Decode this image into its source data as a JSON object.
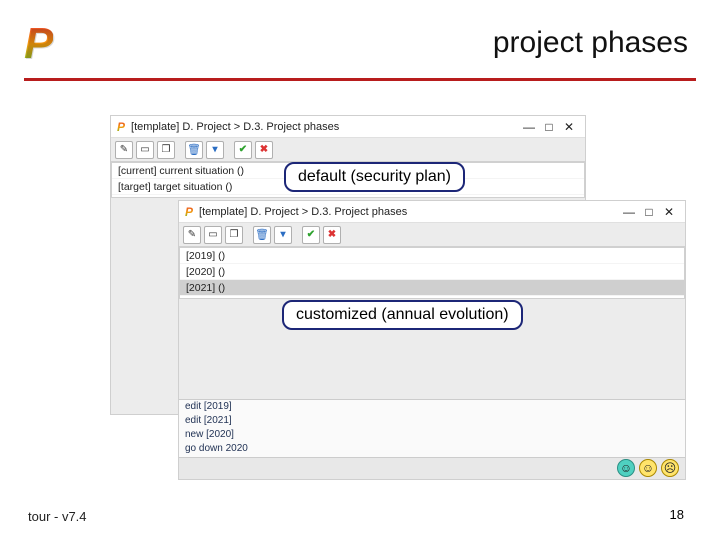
{
  "slide": {
    "logo": "P",
    "title": "project phases",
    "footer_left": "tour - v7.4",
    "page_number": "18"
  },
  "callouts": {
    "default_label": "default (security plan)",
    "customized_label": "customized (annual evolution)"
  },
  "win1": {
    "title": "[template] D. Project > D.3. Project phases",
    "rows": [
      "[current] current situation ()",
      "[target] target situation ()"
    ]
  },
  "win2": {
    "title": "[template] D. Project > D.3. Project phases",
    "rows": [
      "[2019] ()",
      "[2020] ()",
      "[2021] ()"
    ],
    "bottom_rows": [
      "edit [2019]",
      "edit [2021]",
      "new [2020]",
      "go down 2020"
    ]
  },
  "window_controls": {
    "min": "—",
    "max": "□",
    "close": "✕"
  },
  "faces": {
    "happy": "☺",
    "neutral": "☺",
    "sad": "☹"
  }
}
